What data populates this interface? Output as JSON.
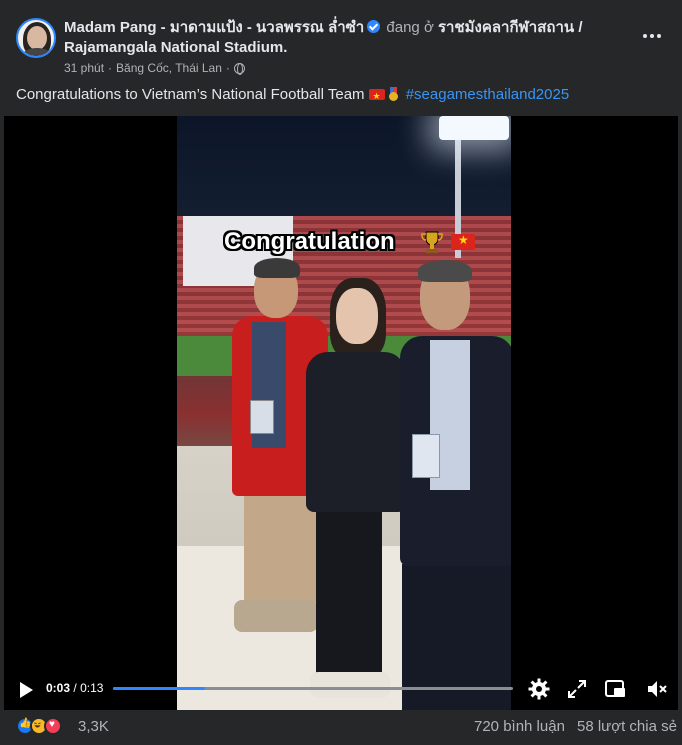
{
  "post": {
    "author": "Madam Pang - มาดามแป้ง - นวลพรรณ ล่ำซำ",
    "at_text": "đang ở",
    "place_line1": "ราชมังคลากีฬาสถาน /",
    "place_line2": "Rajamangala National Stadium.",
    "time": "31 phút",
    "location": "Băng Cốc, Thái Lan",
    "separator": "·",
    "caption": "Congratulations to Vietnam’s National Football Team",
    "hashtag": "#seagamesthailand2025"
  },
  "video": {
    "overlay_text": "Congratulation",
    "current_time": "0:03",
    "duration": "0:13",
    "time_separator": "/",
    "progress": 0.23,
    "icons": [
      "play-icon",
      "settings-icon",
      "fullscreen-icon",
      "picture-in-picture-icon",
      "volume-muted-icon"
    ]
  },
  "footer": {
    "reaction_icons": [
      "like-icon",
      "haha-icon",
      "love-icon"
    ],
    "reaction_count": "3,3K",
    "comments": "720 bình luận",
    "shares": "58 lượt chia sẻ"
  },
  "colors": {
    "background": "#252728",
    "accent": "#2d88ff",
    "hashtag": "#3a95f5",
    "secondary_text": "#b0b3b8"
  }
}
